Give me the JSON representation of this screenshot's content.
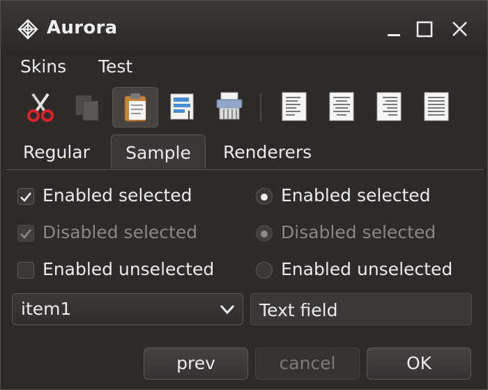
{
  "window": {
    "title": "Aurora"
  },
  "menu": {
    "items": [
      "Skins",
      "Test"
    ]
  },
  "toolbar": {
    "icons": [
      "cut-icon",
      "copy-icon",
      "paste-icon",
      "select-all-icon",
      "delete-icon",
      "align-left-icon",
      "align-center-icon",
      "align-right-icon",
      "align-justify-icon"
    ],
    "active": "paste-icon"
  },
  "tabs": {
    "items": [
      "Regular",
      "Sample",
      "Renderers"
    ],
    "selected": "Sample"
  },
  "checkboxes": [
    {
      "label": "Enabled selected",
      "checked": true,
      "enabled": true
    },
    {
      "label": "Disabled selected",
      "checked": true,
      "enabled": false
    },
    {
      "label": "Enabled unselected",
      "checked": false,
      "enabled": true
    }
  ],
  "radios": [
    {
      "label": "Enabled selected",
      "checked": true,
      "enabled": true
    },
    {
      "label": "Disabled selected",
      "checked": true,
      "enabled": false
    },
    {
      "label": "Enabled unselected",
      "checked": false,
      "enabled": true
    }
  ],
  "combo": {
    "value": "item1"
  },
  "textfield": {
    "value": "Text field"
  },
  "buttons": {
    "prev": "prev",
    "cancel": "cancel",
    "ok": "OK"
  },
  "colors": {
    "background": "#2d2a27",
    "titlebar": "#3a3734",
    "accent_red": "#d8232a"
  }
}
